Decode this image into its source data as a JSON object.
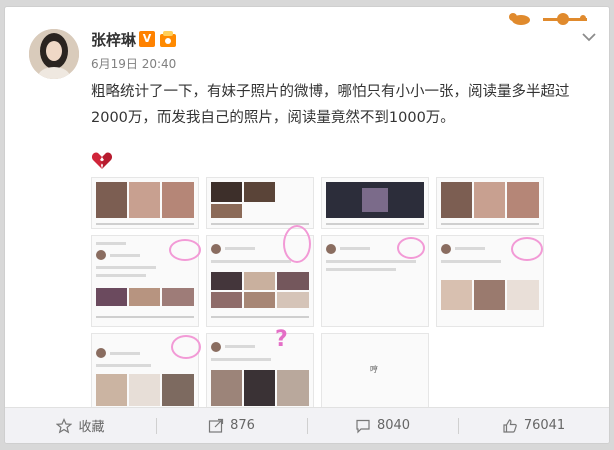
{
  "post": {
    "author": "张梓琳",
    "verified_badge": "V",
    "timestamp": "6月19日 20:40",
    "text": "粗略统计了一下，有妹子照片的微博，哪怕只有小小一张，阅读量多半超过2000万，而发我自己的照片，阅读量竟然不到1000万。",
    "emoji": "broken-heart-icon"
  },
  "grid": {
    "center_label": "哼"
  },
  "footer": {
    "favorite_label": "收藏",
    "repost_count": "876",
    "comment_count": "8040",
    "like_count": "76041"
  },
  "colors": {
    "accent": "#ff8200",
    "annotation": "#f29ad6",
    "heart": "#d0253a"
  }
}
